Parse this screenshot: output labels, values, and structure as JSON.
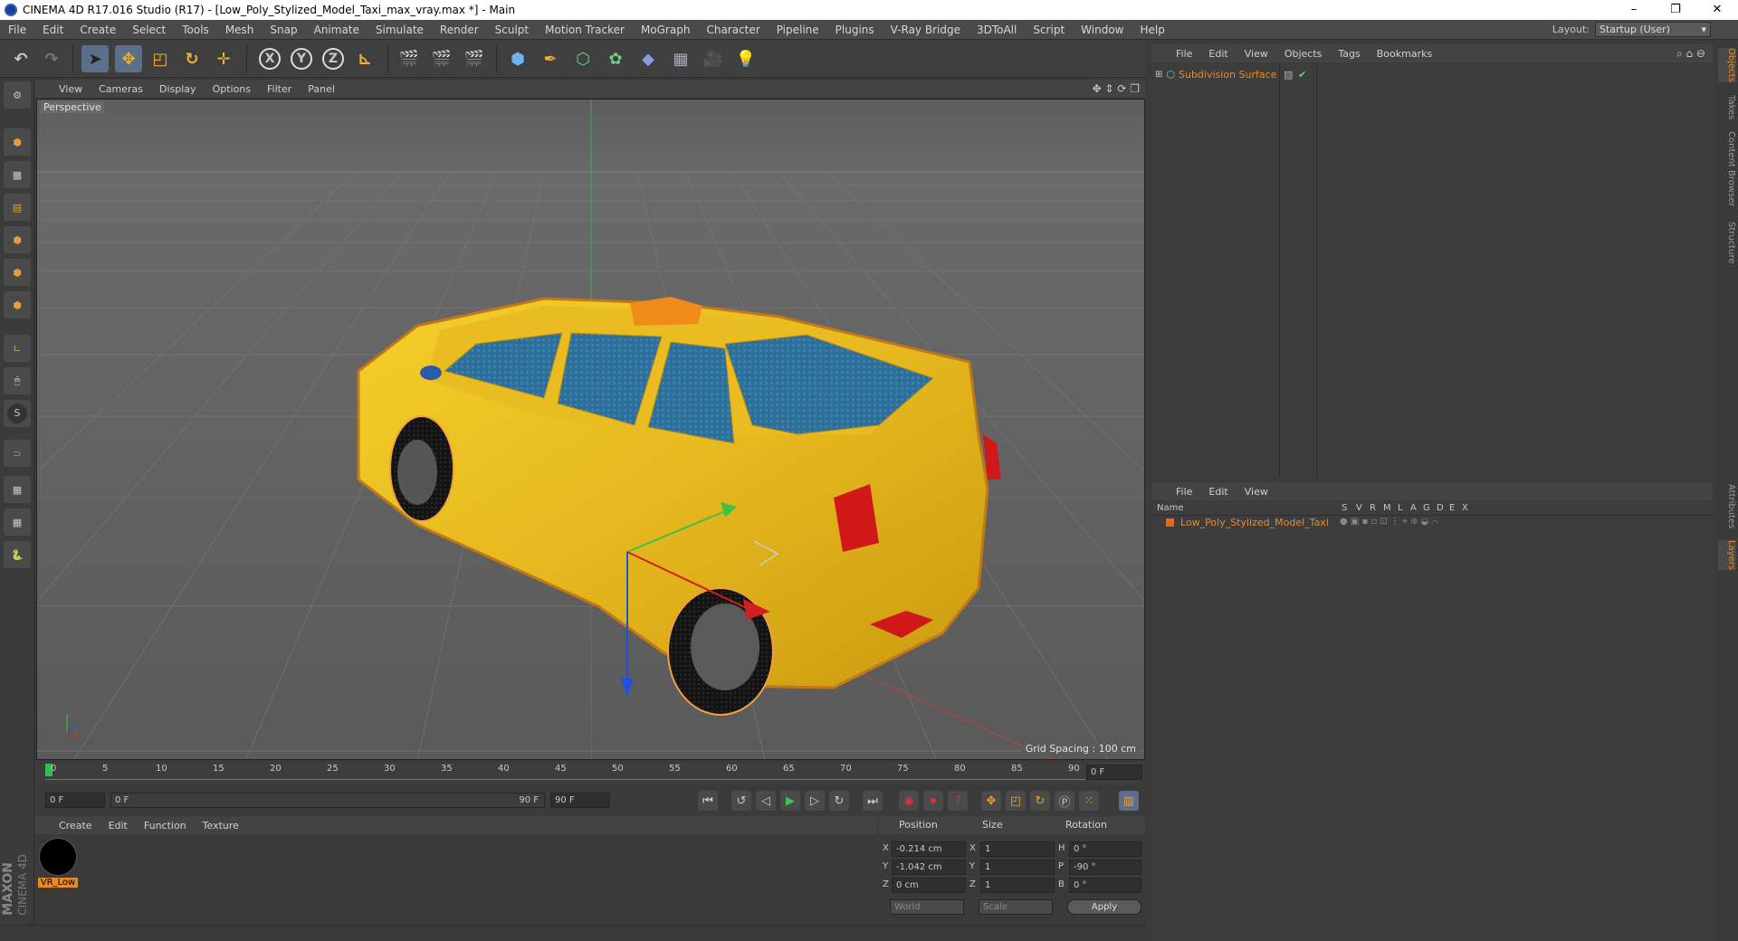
{
  "window": {
    "title": "CINEMA 4D R17.016 Studio (R17) - [Low_Poly_Stylized_Model_Taxi_max_vray.max *] - Main",
    "controls": [
      "–",
      "❐",
      "✕"
    ]
  },
  "menubar": {
    "items": [
      "File",
      "Edit",
      "Create",
      "Select",
      "Tools",
      "Mesh",
      "Snap",
      "Animate",
      "Simulate",
      "Render",
      "Sculpt",
      "Motion Tracker",
      "MoGraph",
      "Character",
      "Pipeline",
      "Plugins",
      "V-Ray Bridge",
      "3DToAll",
      "Script",
      "Window",
      "Help"
    ],
    "layout_label": "Layout:",
    "layout_value": "Startup (User)"
  },
  "toolbar": {
    "axis_x": "X",
    "axis_y": "Y",
    "axis_z": "Z"
  },
  "viewport": {
    "menu": [
      "View",
      "Cameras",
      "Display",
      "Options",
      "Filter",
      "Panel"
    ],
    "label": "Perspective",
    "grid_spacing": "Grid Spacing : 100 cm"
  },
  "timeline": {
    "ticks": [
      "0",
      "5",
      "10",
      "15",
      "20",
      "25",
      "30",
      "35",
      "40",
      "45",
      "50",
      "55",
      "60",
      "65",
      "70",
      "75",
      "80",
      "85",
      "90"
    ],
    "current_frame": "0 F",
    "start_field": "0 F",
    "range_start": "0 F",
    "range_end": "90 F",
    "end_field": "90 F"
  },
  "material_panel": {
    "menu": [
      "Create",
      "Edit",
      "Function",
      "Texture"
    ],
    "material_name": "VR_Low"
  },
  "coordinates": {
    "headers": [
      "Position",
      "Size",
      "Rotation"
    ],
    "rows": [
      {
        "axis": "X",
        "pos": "-0.214 cm",
        "size_axis": "X",
        "size": "1",
        "rot_axis": "H",
        "rot": "0 °"
      },
      {
        "axis": "Y",
        "pos": "-1.042 cm",
        "size_axis": "Y",
        "size": "1",
        "rot_axis": "P",
        "rot": "-90 °"
      },
      {
        "axis": "Z",
        "pos": "0 cm",
        "size_axis": "Z",
        "size": "1",
        "rot_axis": "B",
        "rot": "0 °"
      }
    ],
    "mode": "World",
    "size_mode": "Scale",
    "apply": "Apply"
  },
  "object_manager": {
    "menu": [
      "File",
      "Edit",
      "View",
      "Objects",
      "Tags",
      "Bookmarks"
    ],
    "objects": [
      {
        "name": "Subdivision Surface"
      }
    ]
  },
  "layer_manager": {
    "menu": [
      "File",
      "Edit",
      "View"
    ],
    "columns": [
      "Name",
      "S",
      "V",
      "R",
      "M",
      "L",
      "A",
      "G",
      "D",
      "E",
      "X"
    ],
    "layers": [
      {
        "name": "Low_Poly_Stylized_Model_Taxi"
      }
    ]
  },
  "side_tabs": [
    "Objects",
    "Takes",
    "Content Browser",
    "Structure",
    "Attributes",
    "Layers"
  ],
  "brand": {
    "line1": "MAXON",
    "line2": "CINEMA 4D"
  },
  "colors": {
    "accent": "#e88a2a",
    "active_tool": "#5b6f8a",
    "taxi": "#e6b81e"
  }
}
